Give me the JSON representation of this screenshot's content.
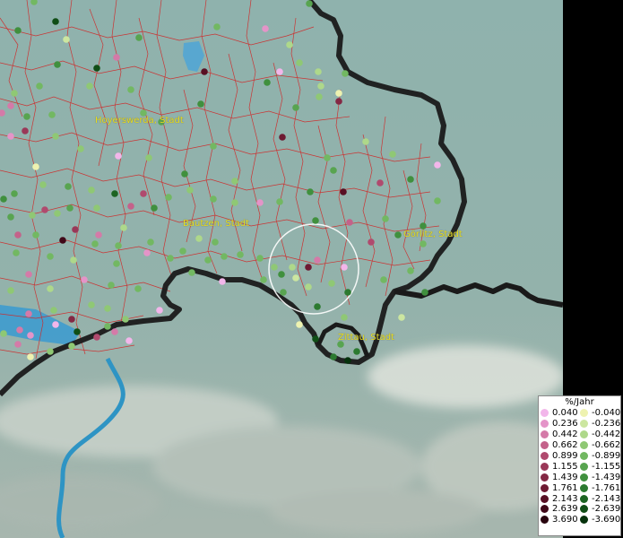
{
  "legend": {
    "title": "%/Jahr",
    "positive": [
      {
        "label": "0.040",
        "color": "#f2b6ea"
      },
      {
        "label": "0.236",
        "color": "#e494c8"
      },
      {
        "label": "0.442",
        "color": "#d47aa8"
      },
      {
        "label": "0.662",
        "color": "#c4628a"
      },
      {
        "label": "0.899",
        "color": "#b04a6e"
      },
      {
        "label": "1.155",
        "color": "#9a3858"
      },
      {
        "label": "1.439",
        "color": "#842844"
      },
      {
        "label": "1.761",
        "color": "#6e1a32"
      },
      {
        "label": "2.143",
        "color": "#581024"
      },
      {
        "label": "2.639",
        "color": "#400818"
      },
      {
        "label": "3.690",
        "color": "#28040e"
      }
    ],
    "negative": [
      {
        "label": "-0.040",
        "color": "#eef2b0"
      },
      {
        "label": "-0.236",
        "color": "#cce6a0"
      },
      {
        "label": "-0.442",
        "color": "#aed88a"
      },
      {
        "label": "-0.662",
        "color": "#8fc874"
      },
      {
        "label": "-0.899",
        "color": "#72b862"
      },
      {
        "label": "-1.155",
        "color": "#58a450"
      },
      {
        "label": "-1.439",
        "color": "#40903e"
      },
      {
        "label": "-1.761",
        "color": "#2c7a30"
      },
      {
        "label": "-2.143",
        "color": "#1c6422"
      },
      {
        "label": "-2.639",
        "color": "#104e16"
      },
      {
        "label": "-3.690",
        "color": "#06320c"
      }
    ]
  },
  "cities": [
    {
      "name": "Hoyerswerda, Stadt"
    },
    {
      "name": "Bautzen, Stadt"
    },
    {
      "name": "Görlitz, Stadt"
    },
    {
      "name": "Zittau, Stadt"
    }
  ],
  "colors": {
    "terrain": "#8fb0aa",
    "water": "#3a9ad0",
    "border": "#1a1a1a",
    "district_lines": "#d02828",
    "label": "#e8e020"
  }
}
